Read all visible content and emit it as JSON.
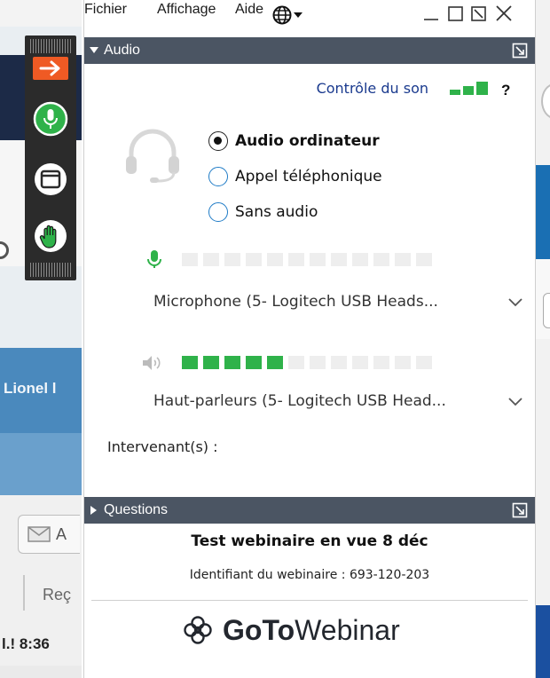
{
  "menu": {
    "file": "Fichier",
    "view": "Affichage",
    "help": "Aide"
  },
  "audio_panel": {
    "header": "Audio",
    "sound_control": "Contrôle du son",
    "help_label": "?",
    "options": [
      {
        "label": "Audio ordinateur",
        "selected": true
      },
      {
        "label": "Appel téléphonique",
        "selected": false
      },
      {
        "label": "Sans audio",
        "selected": false
      }
    ],
    "microphone": {
      "device": "Microphone (5- Logitech USB Heads...",
      "level_segments": 12,
      "level_on": 0
    },
    "speakers": {
      "device": "Haut-parleurs (5- Logitech USB Head...",
      "level_segments": 12,
      "level_on": 5
    },
    "speakers_label": "Intervenant(s) :"
  },
  "questions_panel": {
    "header": "Questions"
  },
  "webinar": {
    "title": "Test webinaire en vue 8 déc",
    "id_text": "Identifiant du webinaire : 693-120-203"
  },
  "logo": {
    "goto": "GoTo",
    "webinar": "Webinar"
  },
  "background": {
    "name_fragment": "Lionel l",
    "mail_fragment": "A",
    "rec_fragment": "Reç",
    "time_fragment": "l.! 8:36"
  },
  "colors": {
    "header_bg": "#4b5563",
    "level_on": "#2fb24a",
    "level_off": "#eeeeee",
    "link": "#1a3a8e",
    "radio_accent": "#1e7bc6"
  }
}
